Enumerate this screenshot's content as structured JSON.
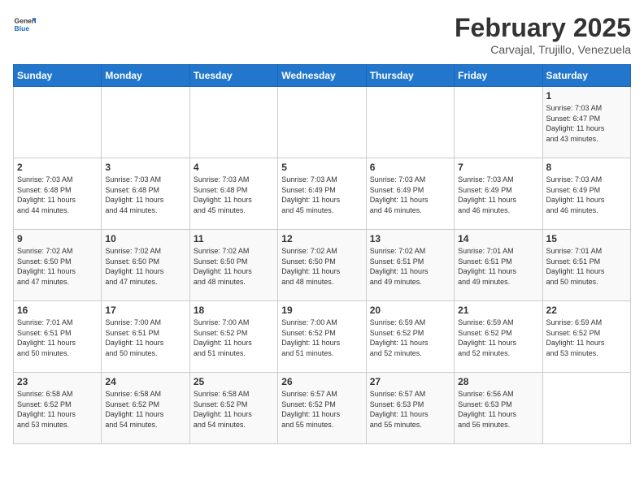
{
  "header": {
    "logo_general": "General",
    "logo_blue": "Blue",
    "month_year": "February 2025",
    "location": "Carvajal, Trujillo, Venezuela"
  },
  "days_of_week": [
    "Sunday",
    "Monday",
    "Tuesday",
    "Wednesday",
    "Thursday",
    "Friday",
    "Saturday"
  ],
  "weeks": [
    [
      {
        "day": "",
        "info": ""
      },
      {
        "day": "",
        "info": ""
      },
      {
        "day": "",
        "info": ""
      },
      {
        "day": "",
        "info": ""
      },
      {
        "day": "",
        "info": ""
      },
      {
        "day": "",
        "info": ""
      },
      {
        "day": "1",
        "info": "Sunrise: 7:03 AM\nSunset: 6:47 PM\nDaylight: 11 hours\nand 43 minutes."
      }
    ],
    [
      {
        "day": "2",
        "info": "Sunrise: 7:03 AM\nSunset: 6:48 PM\nDaylight: 11 hours\nand 44 minutes."
      },
      {
        "day": "3",
        "info": "Sunrise: 7:03 AM\nSunset: 6:48 PM\nDaylight: 11 hours\nand 44 minutes."
      },
      {
        "day": "4",
        "info": "Sunrise: 7:03 AM\nSunset: 6:48 PM\nDaylight: 11 hours\nand 45 minutes."
      },
      {
        "day": "5",
        "info": "Sunrise: 7:03 AM\nSunset: 6:49 PM\nDaylight: 11 hours\nand 45 minutes."
      },
      {
        "day": "6",
        "info": "Sunrise: 7:03 AM\nSunset: 6:49 PM\nDaylight: 11 hours\nand 46 minutes."
      },
      {
        "day": "7",
        "info": "Sunrise: 7:03 AM\nSunset: 6:49 PM\nDaylight: 11 hours\nand 46 minutes."
      },
      {
        "day": "8",
        "info": "Sunrise: 7:03 AM\nSunset: 6:49 PM\nDaylight: 11 hours\nand 46 minutes."
      }
    ],
    [
      {
        "day": "9",
        "info": "Sunrise: 7:02 AM\nSunset: 6:50 PM\nDaylight: 11 hours\nand 47 minutes."
      },
      {
        "day": "10",
        "info": "Sunrise: 7:02 AM\nSunset: 6:50 PM\nDaylight: 11 hours\nand 47 minutes."
      },
      {
        "day": "11",
        "info": "Sunrise: 7:02 AM\nSunset: 6:50 PM\nDaylight: 11 hours\nand 48 minutes."
      },
      {
        "day": "12",
        "info": "Sunrise: 7:02 AM\nSunset: 6:50 PM\nDaylight: 11 hours\nand 48 minutes."
      },
      {
        "day": "13",
        "info": "Sunrise: 7:02 AM\nSunset: 6:51 PM\nDaylight: 11 hours\nand 49 minutes."
      },
      {
        "day": "14",
        "info": "Sunrise: 7:01 AM\nSunset: 6:51 PM\nDaylight: 11 hours\nand 49 minutes."
      },
      {
        "day": "15",
        "info": "Sunrise: 7:01 AM\nSunset: 6:51 PM\nDaylight: 11 hours\nand 50 minutes."
      }
    ],
    [
      {
        "day": "16",
        "info": "Sunrise: 7:01 AM\nSunset: 6:51 PM\nDaylight: 11 hours\nand 50 minutes."
      },
      {
        "day": "17",
        "info": "Sunrise: 7:00 AM\nSunset: 6:51 PM\nDaylight: 11 hours\nand 50 minutes."
      },
      {
        "day": "18",
        "info": "Sunrise: 7:00 AM\nSunset: 6:52 PM\nDaylight: 11 hours\nand 51 minutes."
      },
      {
        "day": "19",
        "info": "Sunrise: 7:00 AM\nSunset: 6:52 PM\nDaylight: 11 hours\nand 51 minutes."
      },
      {
        "day": "20",
        "info": "Sunrise: 6:59 AM\nSunset: 6:52 PM\nDaylight: 11 hours\nand 52 minutes."
      },
      {
        "day": "21",
        "info": "Sunrise: 6:59 AM\nSunset: 6:52 PM\nDaylight: 11 hours\nand 52 minutes."
      },
      {
        "day": "22",
        "info": "Sunrise: 6:59 AM\nSunset: 6:52 PM\nDaylight: 11 hours\nand 53 minutes."
      }
    ],
    [
      {
        "day": "23",
        "info": "Sunrise: 6:58 AM\nSunset: 6:52 PM\nDaylight: 11 hours\nand 53 minutes."
      },
      {
        "day": "24",
        "info": "Sunrise: 6:58 AM\nSunset: 6:52 PM\nDaylight: 11 hours\nand 54 minutes."
      },
      {
        "day": "25",
        "info": "Sunrise: 6:58 AM\nSunset: 6:52 PM\nDaylight: 11 hours\nand 54 minutes."
      },
      {
        "day": "26",
        "info": "Sunrise: 6:57 AM\nSunset: 6:52 PM\nDaylight: 11 hours\nand 55 minutes."
      },
      {
        "day": "27",
        "info": "Sunrise: 6:57 AM\nSunset: 6:53 PM\nDaylight: 11 hours\nand 55 minutes."
      },
      {
        "day": "28",
        "info": "Sunrise: 6:56 AM\nSunset: 6:53 PM\nDaylight: 11 hours\nand 56 minutes."
      },
      {
        "day": "",
        "info": ""
      }
    ]
  ]
}
